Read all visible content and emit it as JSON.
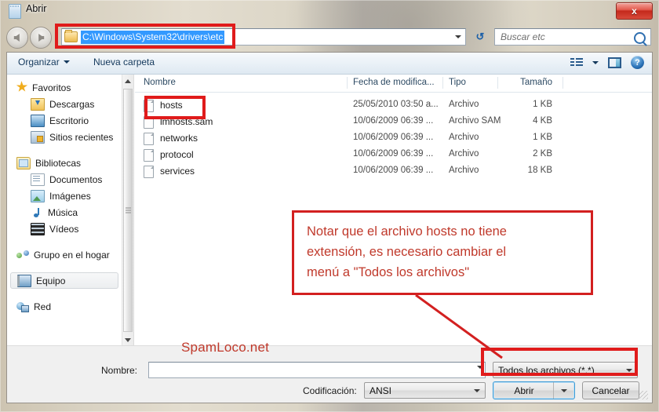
{
  "window": {
    "title": "Abrir",
    "title_icon": "notepad-icon",
    "close_label": "x"
  },
  "navigation": {
    "back_icon": "back-arrow-icon",
    "forward_icon": "forward-arrow-icon",
    "address_path": "C:\\Windows\\System32\\drivers\\etc",
    "address_folder_icon": "folder-icon",
    "address_dropdown_icon": "chevron-down-icon",
    "refresh_icon": "refresh-icon",
    "refresh_glyph": "↺",
    "search_placeholder": "Buscar etc",
    "search_icon": "search-icon"
  },
  "toolbar": {
    "organizar_label": "Organizar",
    "nueva_carpeta_label": "Nueva carpeta",
    "view_icon": "list-view-icon",
    "view_dropdown_icon": "chevron-down-icon",
    "preview_pane_icon": "preview-pane-icon",
    "help_icon": "help-icon",
    "help_glyph": "?"
  },
  "sidebar": {
    "items": [
      {
        "label": "Favoritos",
        "icon": "star-icon",
        "level": "top",
        "selected": false
      },
      {
        "label": "Descargas",
        "icon": "downloads-icon",
        "level": "sub",
        "selected": false
      },
      {
        "label": "Escritorio",
        "icon": "desktop-icon",
        "level": "sub",
        "selected": false
      },
      {
        "label": "Sitios recientes",
        "icon": "recent-places-icon",
        "level": "sub",
        "selected": false
      },
      {
        "label": "Bibliotecas",
        "icon": "libraries-icon",
        "level": "top",
        "selected": false
      },
      {
        "label": "Documentos",
        "icon": "documents-icon",
        "level": "sub",
        "selected": false
      },
      {
        "label": "Imágenes",
        "icon": "pictures-icon",
        "level": "sub",
        "selected": false
      },
      {
        "label": "Música",
        "icon": "music-icon",
        "level": "sub",
        "selected": false
      },
      {
        "label": "Vídeos",
        "icon": "videos-icon",
        "level": "sub",
        "selected": false
      },
      {
        "label": "Grupo en el hogar",
        "icon": "homegroup-icon",
        "level": "top",
        "selected": false
      },
      {
        "label": "Equipo",
        "icon": "computer-icon",
        "level": "top",
        "selected": true
      },
      {
        "label": "Red",
        "icon": "network-icon",
        "level": "top",
        "selected": false
      }
    ]
  },
  "scrollbar": {
    "up_icon": "scroll-up-arrow-icon",
    "down_icon": "scroll-down-arrow-icon",
    "grip_icon": "splitter-grip-icon"
  },
  "filelist": {
    "columns": [
      "Nombre",
      "Fecha de modifica...",
      "Tipo",
      "Tamaño"
    ],
    "rows": [
      {
        "name": "hosts",
        "date": "25/05/2010 03:50 a...",
        "type": "Archivo",
        "size": "1 KB",
        "icon": "file-icon"
      },
      {
        "name": "lmhosts.sam",
        "date": "10/06/2009 06:39 ...",
        "type": "Archivo SAM",
        "size": "4 KB",
        "icon": "file-icon"
      },
      {
        "name": "networks",
        "date": "10/06/2009 06:39 ...",
        "type": "Archivo",
        "size": "1 KB",
        "icon": "file-icon"
      },
      {
        "name": "protocol",
        "date": "10/06/2009 06:39 ...",
        "type": "Archivo",
        "size": "2 KB",
        "icon": "file-icon"
      },
      {
        "name": "services",
        "date": "10/06/2009 06:39 ...",
        "type": "Archivo",
        "size": "18 KB",
        "icon": "file-icon"
      }
    ]
  },
  "bottom": {
    "nombre_label": "Nombre:",
    "nombre_value": "",
    "nombre_dropdown_icon": "chevron-down-icon",
    "filter_value": "Todos los archivos  (*.*)",
    "filter_dropdown_icon": "chevron-down-icon",
    "codificacion_label": "Codificación:",
    "codificacion_value": "ANSI",
    "codificacion_dropdown_icon": "chevron-down-icon",
    "abrir_label": "Abrir",
    "abrir_split_icon": "chevron-down-icon",
    "cancelar_label": "Cancelar",
    "resize_grip_icon": "resize-grip-icon"
  },
  "annotations": {
    "watermark": "SpamLoco.net",
    "callout_line1": "Notar que el archivo hosts no tiene",
    "callout_line2": "extensión, es necesario cambiar el",
    "callout_line3": "menú a \"Todos los archivos\"",
    "highlight_color": "#e01b1b",
    "callout_text_color": "#c0392b"
  }
}
